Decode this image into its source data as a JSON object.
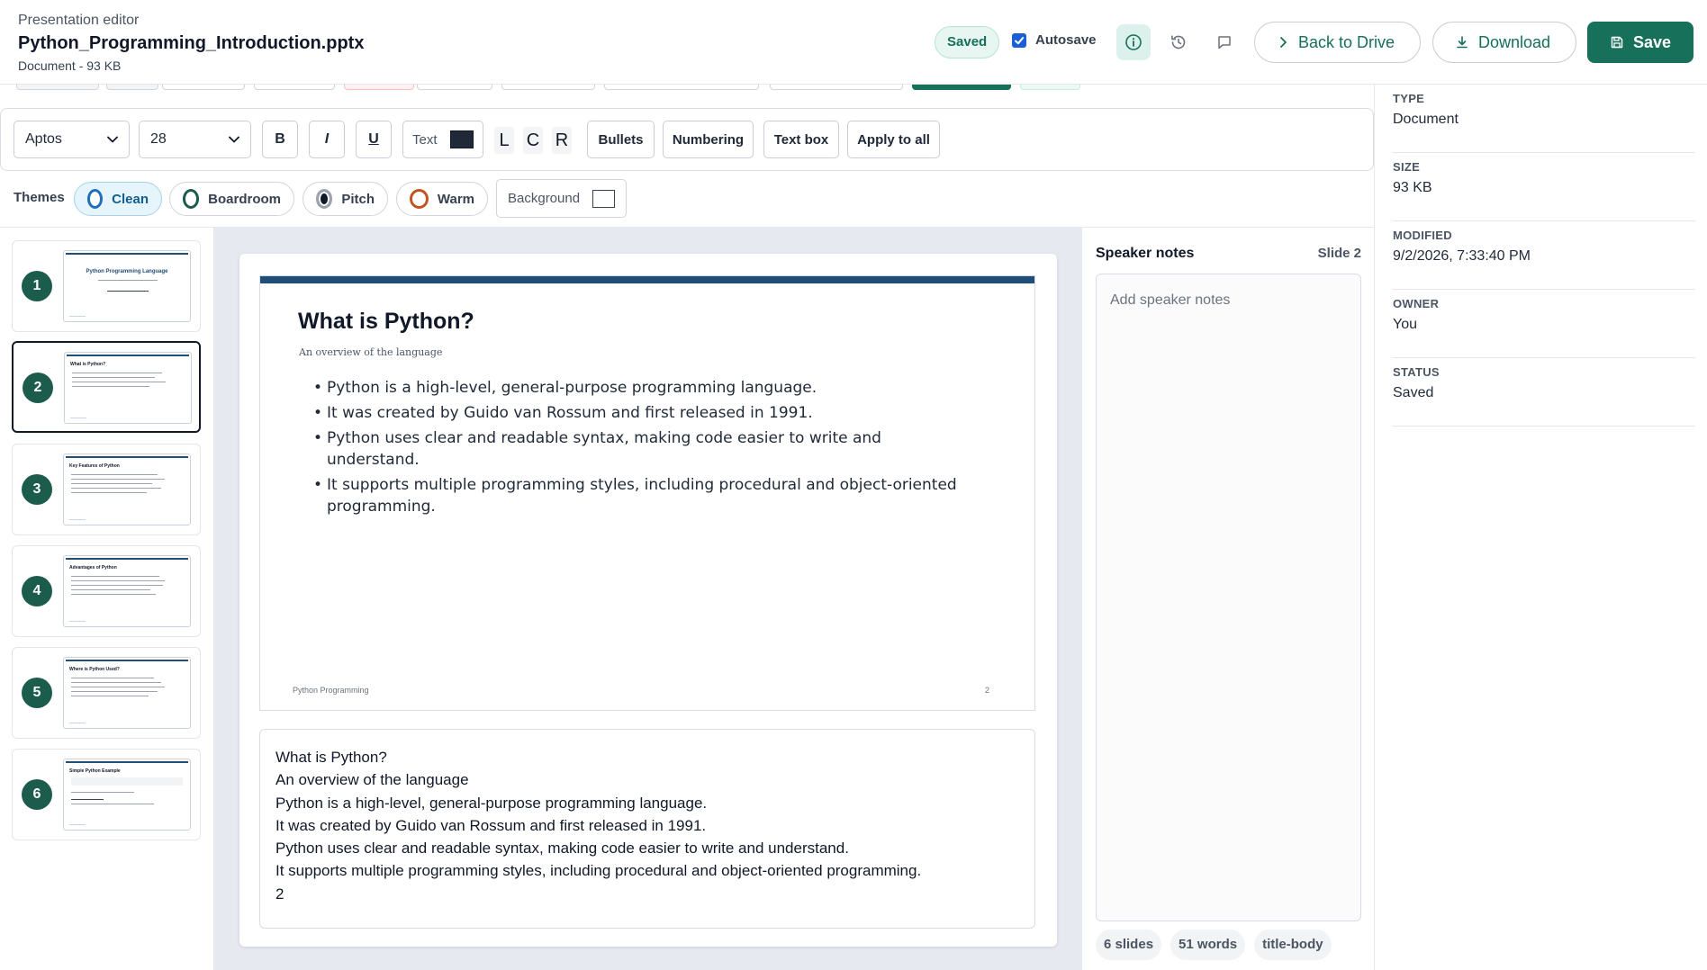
{
  "header": {
    "app_label": "Presentation editor",
    "file_name": "Python_Programming_Introduction.pptx",
    "file_meta": "Document - 93 KB",
    "saved_badge": "Saved",
    "autosave_label": "Autosave",
    "autosave_checked": true,
    "back_label": "Back to Drive",
    "download_label": "Download",
    "save_label": "Save"
  },
  "toolbar": {
    "font": "Aptos",
    "size": "28",
    "bold": "B",
    "italic": "I",
    "underline": "U",
    "text_color_label": "Text",
    "text_color": "#1f2937",
    "align_left": "L",
    "align_center": "C",
    "align_right": "R",
    "bullets": "Bullets",
    "numbering": "Numbering",
    "text_box": "Text box",
    "apply_all": "Apply to all"
  },
  "themes": {
    "label": "Themes",
    "items": [
      {
        "name": "Clean",
        "color": "#1f6fbd"
      },
      {
        "name": "Boardroom",
        "color": "#1b5c4c"
      },
      {
        "name": "Pitch",
        "color": "#111827"
      },
      {
        "name": "Warm",
        "color": "#c2551f"
      }
    ],
    "background_label": "Background"
  },
  "slides": [
    {
      "num": "1",
      "title": "Python Programming Language"
    },
    {
      "num": "2",
      "title": "What is Python?"
    },
    {
      "num": "3",
      "title": "Key Features of Python"
    },
    {
      "num": "4",
      "title": "Advantages of Python"
    },
    {
      "num": "5",
      "title": "Where is Python Used?"
    },
    {
      "num": "6",
      "title": "Simple Python Example"
    }
  ],
  "current_slide": {
    "title": "What is Python?",
    "subtitle": "An overview of the language",
    "bullets": [
      "Python is a high-level, general-purpose programming language.",
      "It was created by Guido van Rossum and first released in 1991.",
      "Python uses clear and readable syntax, making code easier to write and understand.",
      "It supports multiple programming styles, including procedural and object-oriented programming."
    ],
    "footer": "Python Programming",
    "number": "2"
  },
  "text_lines": [
    "What is Python?",
    "An overview of the language",
    "Python is a high-level, general-purpose programming language.",
    "It was created by Guido van Rossum and first released in 1991.",
    "Python uses clear and readable syntax, making code easier to write and understand.",
    "It supports multiple programming styles, including procedural and object-oriented programming.",
    "2"
  ],
  "notes": {
    "title": "Speaker notes",
    "slide_label": "Slide 2",
    "placeholder": "Add speaker notes"
  },
  "stats": [
    "6 slides",
    "51 words",
    "title-body"
  ],
  "info": [
    {
      "label": "TYPE",
      "value": "Document"
    },
    {
      "label": "SIZE",
      "value": "93 KB"
    },
    {
      "label": "MODIFIED",
      "value": "9/2/2026, 7:33:40 PM"
    },
    {
      "label": "OWNER",
      "value": "You"
    },
    {
      "label": "STATUS",
      "value": "Saved"
    }
  ],
  "colors": {
    "brand": "#17705a",
    "slide_accent": "#1f4e79"
  }
}
